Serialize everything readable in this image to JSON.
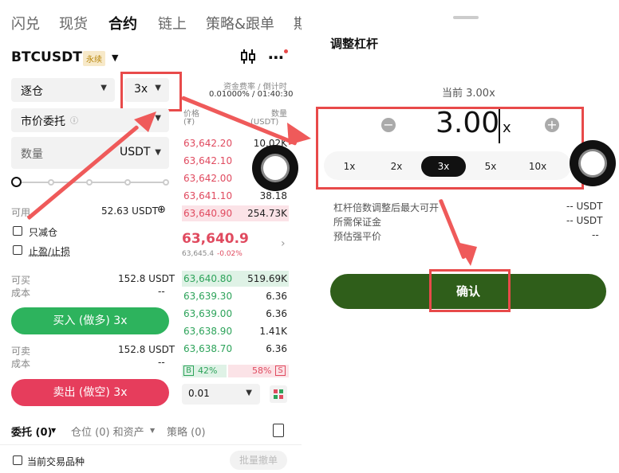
{
  "left": {
    "nav_tabs": [
      "闪兑",
      "现货",
      "合约",
      "链上",
      "策略&跟单",
      "期"
    ],
    "pair": "BTCUSDT",
    "pair_tag": "永续",
    "margin_mode": "逐仓",
    "leverage": "3x",
    "funding_label": "资金费率 / 倒计时",
    "funding_value": "0.01000% / 01:40:30",
    "order_type": "市价委托",
    "qty_placeholder": "数量",
    "qty_unit": "USDT",
    "available_label": "可用",
    "available_value": "52.63 USDT",
    "reduce_only": "只减仓",
    "tp_sl": "止盈/止损",
    "can_buy_label": "可买",
    "can_buy_value": "152.8 USDT",
    "cost_label": "成本",
    "cost_value": "--",
    "buy_button": "买入 (做多) 3x",
    "can_sell_label": "可卖",
    "can_sell_value": "152.8 USDT",
    "cost2_label": "成本",
    "cost2_value": "--",
    "sell_button": "卖出 (做空) 3x",
    "bottom_tabs": [
      "委托 (0)",
      "仓位 (0) 和资产",
      "策略 (0)"
    ],
    "current_pair": "当前交易品种",
    "batch_cancel": "批量撤单"
  },
  "orderbook": {
    "price_header": "价格",
    "price_unit": "(₮)",
    "qty_header": "数量",
    "qty_unit": "(USDT)",
    "asks": [
      {
        "p": "63,642.20",
        "q": "10.02K"
      },
      {
        "p": "63,642.10",
        "q": ""
      },
      {
        "p": "63,642.00",
        "q": ""
      },
      {
        "p": "63,641.10",
        "q": "38.18"
      },
      {
        "p": "63,640.90",
        "q": "254.73K"
      }
    ],
    "last_price": "63,640.9",
    "mark_price": "63,645.4",
    "change": "-0.02%",
    "bids": [
      {
        "p": "63,640.80",
        "q": "519.69K"
      },
      {
        "p": "63,639.30",
        "q": "6.36"
      },
      {
        "p": "63,639.00",
        "q": "6.36"
      },
      {
        "p": "63,638.90",
        "q": "1.41K"
      },
      {
        "p": "63,638.70",
        "q": "6.36"
      }
    ],
    "buy_pct_label": "B",
    "buy_pct": "42%",
    "sell_pct": "58%",
    "sell_pct_label": "S",
    "tick": "0.01"
  },
  "modal": {
    "title": "调整杠杆",
    "current_label": "当前 3.00x",
    "value": "3.00",
    "unit": "x",
    "presets": [
      "1x",
      "2x",
      "3x",
      "5x",
      "10x"
    ],
    "info_rows": [
      {
        "k": "杠杆倍数调整后最大可开",
        "v": "-- USDT"
      },
      {
        "k": "所需保证金",
        "v": "-- USDT"
      },
      {
        "k": "预估强平价",
        "v": "--"
      }
    ],
    "confirm": "确认"
  },
  "colors": {
    "buy": "#2db35d",
    "sell": "#e63d5c",
    "confirm": "#2f5e1a",
    "annotation": "#e84a4a"
  }
}
